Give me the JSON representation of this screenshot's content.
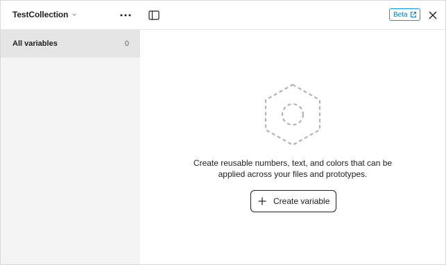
{
  "sidebar": {
    "collection_name": "TestCollection",
    "collection_icon": "chevron-down-icon",
    "more_icon": "more-horizontal-icon",
    "items": [
      {
        "label": "All variables",
        "count": "0",
        "selected": true
      }
    ]
  },
  "header": {
    "toggle_icon": "sidebar-toggle-icon",
    "beta_label": "Beta",
    "beta_icon": "external-link-icon",
    "close_icon": "close-icon"
  },
  "empty_state": {
    "illustration_icon": "dashed-hexagon-icon",
    "description_line1": "Create reusable numbers, text, and colors that can be",
    "description_line2": "applied across your files and prototypes.",
    "button_label": "Create variable",
    "button_icon": "plus-icon"
  },
  "colors": {
    "sidebar_bg": "#f4f4f4",
    "selected_item_bg": "#e5e5e5",
    "beta_accent": "#0d99ff",
    "text": "#1e1e1e"
  }
}
